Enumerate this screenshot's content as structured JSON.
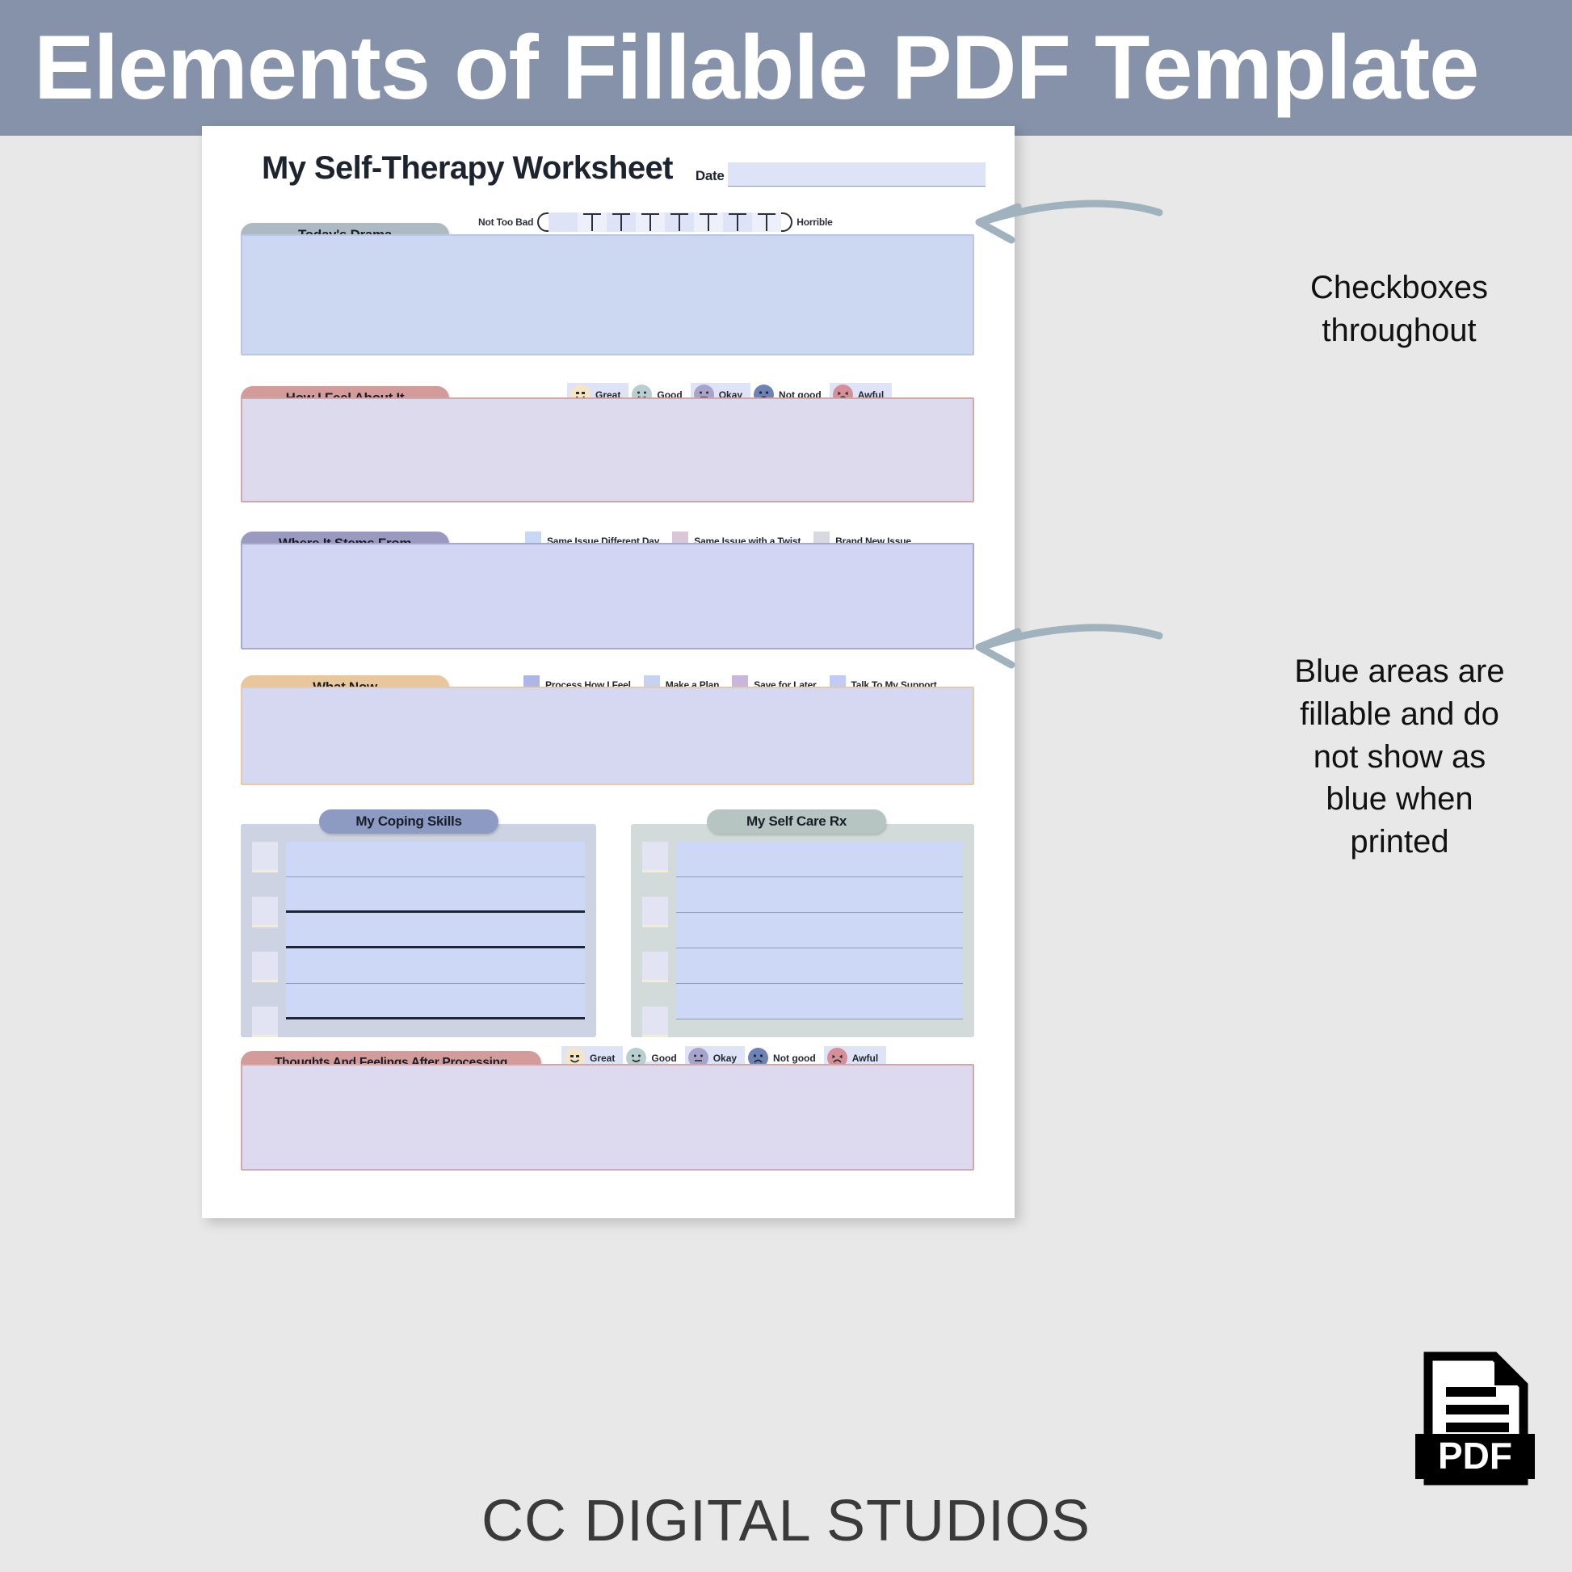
{
  "banner": {
    "title": "Elements of Fillable PDF Template"
  },
  "worksheet": {
    "title": "My Self-Therapy Worksheet",
    "date_label": "Date",
    "date_value": "",
    "scale": {
      "low_label": "Not Too Bad",
      "high_label": "Horrible",
      "ticks": 7
    },
    "sections": [
      {
        "id": "todays-drama",
        "title": "Today's Drama",
        "pill_color": "#aebac2",
        "body_color": "#ccd8f2",
        "border_color": "#b9c6e4"
      },
      {
        "id": "how-i-feel",
        "title": "How I Feel About It",
        "pill_color": "#d49b9b",
        "body_color": "#dedaee",
        "border_color": "#cfa9a9"
      },
      {
        "id": "where-it-stems-from",
        "title": "Where It Stems From",
        "pill_color": "#9a9ac0",
        "body_color": "#d3d6f3",
        "border_color": "#a9a9cd"
      },
      {
        "id": "what-now",
        "title": "What Now",
        "pill_color": "#e8c79c",
        "body_color": "#d5d8f0",
        "border_color": "#e3cba7"
      },
      {
        "id": "thoughts-after-processing",
        "title": "Thoughts And Feelings After Processing",
        "pill_color": "#d49b9b",
        "body_color": "#ddd9ee",
        "border_color": "#cfa9a9"
      }
    ],
    "mood_options": [
      {
        "label": "Great",
        "color": "#f5e6c8"
      },
      {
        "label": "Good",
        "color": "#b9cfcf"
      },
      {
        "label": "Okay",
        "color": "#a7a3cb"
      },
      {
        "label": "Not good",
        "color": "#6d82b5"
      },
      {
        "label": "Awful",
        "color": "#d58f98"
      }
    ],
    "stems_options": [
      {
        "label": "Same Issue Different Day",
        "color": "#c7d8f2"
      },
      {
        "label": "Same Issue with a Twist",
        "color": "#d9c6d8"
      },
      {
        "label": "Brand New Issue",
        "color": "#d8d8e0"
      }
    ],
    "what_now_options": [
      {
        "label": "Process How I Feel",
        "color": "#aeb6e8"
      },
      {
        "label": "Make a Plan",
        "color": "#c7d1f2"
      },
      {
        "label": "Save for Later",
        "color": "#c9b6dd"
      },
      {
        "label": "Talk To My Support",
        "color": "#c2cbf5"
      }
    ],
    "lists": [
      {
        "id": "my-coping-skills",
        "title": "My Coping Skills",
        "pill_color": "#8d9ac1",
        "panel_color": "#cdd3e2",
        "rows": 5
      },
      {
        "id": "my-self-care-rx",
        "title": "My Self Care Rx",
        "pill_color": "#b6c4c2",
        "panel_color": "#d2dbd9",
        "rows": 5
      }
    ]
  },
  "annotations": [
    {
      "id": "checkboxes-note",
      "text": "Checkboxes\nthroughout"
    },
    {
      "id": "blue-areas-note",
      "text": "Blue areas are fillable and do not show as blue when printed"
    }
  ],
  "footer": {
    "brand": "CC DIGITAL STUDIOS",
    "badge": "PDF"
  },
  "colors": {
    "banner_bg": "#8592a9",
    "page_bg": "#e8e8e8",
    "fillable_blue": "#dfe3f7",
    "arrow": "#9fb2bd"
  }
}
